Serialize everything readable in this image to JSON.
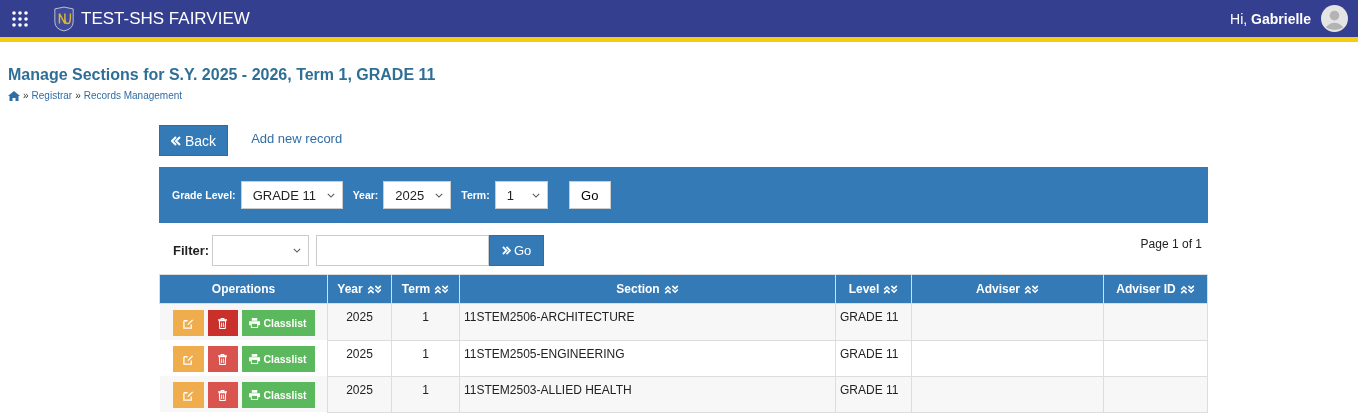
{
  "header": {
    "app_name": "TEST-SHS FAIRVIEW",
    "greeting": "Hi,",
    "user": "Gabrielle"
  },
  "page_title": "Manage Sections for S.Y. 2025 - 2026, Term 1, GRADE 11",
  "breadcrumb": [
    {
      "separator": "»",
      "label": "Registrar"
    },
    {
      "separator": "»",
      "label": "Records Management"
    }
  ],
  "actions": {
    "back": "Back",
    "add": "Add new record"
  },
  "selector_bar": [
    {
      "label": "Grade Level:",
      "value": "GRADE 11"
    },
    {
      "label": "Year:",
      "value": "2025"
    },
    {
      "label": "Term:",
      "value": "1"
    }
  ],
  "selector_go": "Go",
  "filter": {
    "label": "Filter:",
    "go": "Go"
  },
  "pagination": "Page 1 of 1",
  "table": {
    "columns": [
      {
        "label": "Operations",
        "sortable": false
      },
      {
        "label": "Year",
        "sortable": true
      },
      {
        "label": "Term",
        "sortable": true
      },
      {
        "label": "Section",
        "sortable": true
      },
      {
        "label": "Level",
        "sortable": true
      },
      {
        "label": "Adviser",
        "sortable": true
      },
      {
        "label": "Adviser ID",
        "sortable": true
      }
    ],
    "rows": [
      {
        "classlist": "Classlist",
        "year": "2025",
        "term": "1",
        "section": "11STEM2506-ARCHITECTURE",
        "level": "GRADE 11",
        "delete_hovered": true
      },
      {
        "classlist": "Classlist",
        "year": "2025",
        "term": "1",
        "section": "11STEM2505-ENGINEERING",
        "level": "GRADE 11",
        "delete_hovered": false
      },
      {
        "classlist": "Classlist",
        "year": "2025",
        "term": "1",
        "section": "11STEM2503-ALLIED HEALTH",
        "level": "GRADE 11",
        "delete_hovered": false
      }
    ]
  }
}
